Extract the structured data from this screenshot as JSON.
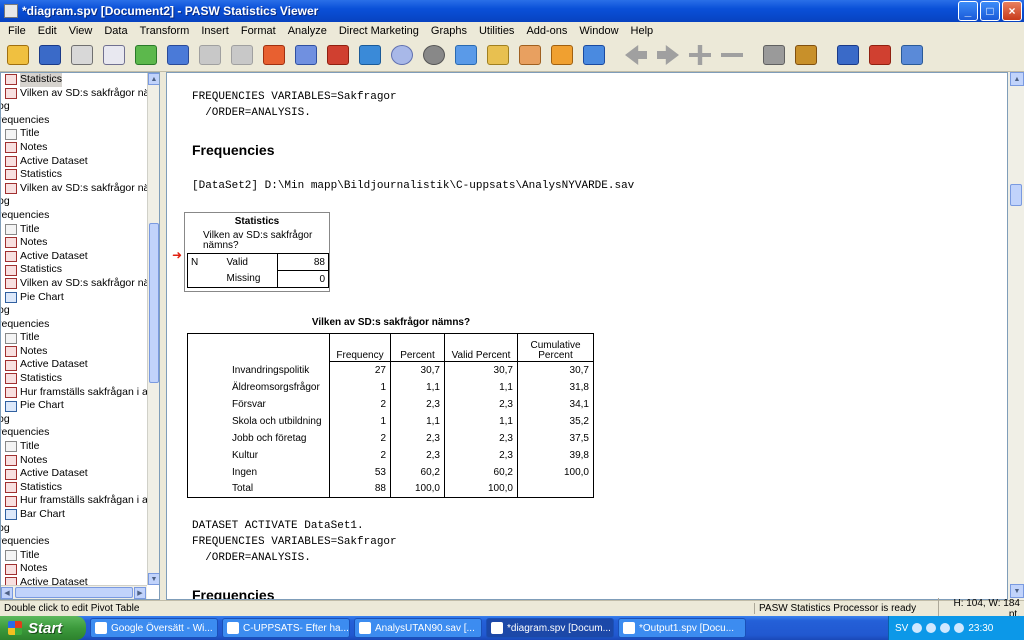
{
  "window": {
    "title": "*diagram.spv [Document2] - PASW Statistics Viewer"
  },
  "menu": [
    "File",
    "Edit",
    "View",
    "Data",
    "Transform",
    "Insert",
    "Format",
    "Analyze",
    "Direct Marketing",
    "Graphs",
    "Utilities",
    "Add-ons",
    "Window",
    "Help"
  ],
  "tree": [
    {
      "label": "Statistics",
      "kind": "ind",
      "icon": "red",
      "sel": true
    },
    {
      "label": "Vilken av SD:s sakfrågor nämns",
      "kind": "ind",
      "icon": "red"
    },
    {
      "label": "og",
      "kind": "top",
      "icon": ""
    },
    {
      "label": "requencies",
      "kind": "top",
      "icon": ""
    },
    {
      "label": "Title",
      "kind": "ind",
      "icon": "plain"
    },
    {
      "label": "Notes",
      "kind": "ind",
      "icon": "red"
    },
    {
      "label": "Active Dataset",
      "kind": "ind",
      "icon": "red"
    },
    {
      "label": "Statistics",
      "kind": "ind",
      "icon": "red"
    },
    {
      "label": "Vilken av SD:s sakfrågor nämns",
      "kind": "ind",
      "icon": "red"
    },
    {
      "label": "og",
      "kind": "top",
      "icon": ""
    },
    {
      "label": "requencies",
      "kind": "top",
      "icon": ""
    },
    {
      "label": "Title",
      "kind": "ind",
      "icon": "plain"
    },
    {
      "label": "Notes",
      "kind": "ind",
      "icon": "red"
    },
    {
      "label": "Active Dataset",
      "kind": "ind",
      "icon": "red"
    },
    {
      "label": "Statistics",
      "kind": "ind",
      "icon": "red"
    },
    {
      "label": "Vilken av SD:s sakfrågor nämns",
      "kind": "ind",
      "icon": "red"
    },
    {
      "label": "Pie Chart",
      "kind": "ind",
      "icon": "blue"
    },
    {
      "label": "og",
      "kind": "top",
      "icon": ""
    },
    {
      "label": "requencies",
      "kind": "top",
      "icon": ""
    },
    {
      "label": "Title",
      "kind": "ind",
      "icon": "plain"
    },
    {
      "label": "Notes",
      "kind": "ind",
      "icon": "red"
    },
    {
      "label": "Active Dataset",
      "kind": "ind",
      "icon": "red"
    },
    {
      "label": "Statistics",
      "kind": "ind",
      "icon": "red"
    },
    {
      "label": "Hur framställs sakfrågan i art",
      "kind": "ind",
      "icon": "red"
    },
    {
      "label": "Pie Chart",
      "kind": "ind",
      "icon": "blue"
    },
    {
      "label": "og",
      "kind": "top",
      "icon": ""
    },
    {
      "label": "requencies",
      "kind": "top",
      "icon": ""
    },
    {
      "label": "Title",
      "kind": "ind",
      "icon": "plain"
    },
    {
      "label": "Notes",
      "kind": "ind",
      "icon": "red"
    },
    {
      "label": "Active Dataset",
      "kind": "ind",
      "icon": "red"
    },
    {
      "label": "Statistics",
      "kind": "ind",
      "icon": "red"
    },
    {
      "label": "Hur framställs sakfrågan i art",
      "kind": "ind",
      "icon": "red"
    },
    {
      "label": "Bar Chart",
      "kind": "ind",
      "icon": "blue"
    },
    {
      "label": "og",
      "kind": "top",
      "icon": ""
    },
    {
      "label": "requencies",
      "kind": "top",
      "icon": ""
    },
    {
      "label": "Title",
      "kind": "ind",
      "icon": "plain"
    },
    {
      "label": "Notes",
      "kind": "ind",
      "icon": "red"
    },
    {
      "label": "Active Dataset",
      "kind": "ind",
      "icon": "red"
    }
  ],
  "content": {
    "syntax1_line1": "FREQUENCIES VARIABLES=Sakfragor",
    "syntax1_line2": "  /ORDER=ANALYSIS.",
    "heading1": "Frequencies",
    "dataset_line": "[DataSet2] D:\\Min mapp\\Bildjournalistik\\C-uppsats\\AnalysNYVARDE.sav",
    "stats": {
      "caption": "Statistics",
      "variable": "Vilken av SD:s sakfrågor nämns?",
      "n_label": "N",
      "valid_label": "Valid",
      "valid_value": "88",
      "missing_label": "Missing",
      "missing_value": "0"
    },
    "freq": {
      "caption": "Vilken av SD:s sakfrågor nämns?",
      "headers": [
        "Frequency",
        "Percent",
        "Valid Percent",
        "Cumulative Percent"
      ],
      "rows": [
        [
          "Invandringspolitik",
          "27",
          "30,7",
          "30,7",
          "30,7"
        ],
        [
          "Äldreomsorgsfrågor",
          "1",
          "1,1",
          "1,1",
          "31,8"
        ],
        [
          "Försvar",
          "2",
          "2,3",
          "2,3",
          "34,1"
        ],
        [
          "Skola och utbildning",
          "1",
          "1,1",
          "1,1",
          "35,2"
        ],
        [
          "Jobb och företag",
          "2",
          "2,3",
          "2,3",
          "37,5"
        ],
        [
          "Kultur",
          "2",
          "2,3",
          "2,3",
          "39,8"
        ],
        [
          "Ingen",
          "53",
          "60,2",
          "60,2",
          "100,0"
        ],
        [
          "Total",
          "88",
          "100,0",
          "100,0",
          ""
        ]
      ]
    },
    "syntax2_line1": "DATASET ACTIVATE DataSet1.",
    "syntax2_line2": "FREQUENCIES VARIABLES=Sakfragor",
    "syntax2_line3": "  /ORDER=ANALYSIS.",
    "heading2": "Frequencies"
  },
  "status": {
    "hint": "Double click to edit Pivot Table",
    "processor": "PASW Statistics Processor is ready",
    "dims": "H: 104, W: 184 pt."
  },
  "taskbar": {
    "start": "Start",
    "tasks": [
      "Google Översätt - Wi...",
      "C-UPPSATS- Efter ha...",
      "AnalysUTAN90.sav [...",
      "*diagram.spv [Docum...",
      "*Output1.spv [Docu..."
    ],
    "lang": "SV",
    "clock": "23:30"
  }
}
